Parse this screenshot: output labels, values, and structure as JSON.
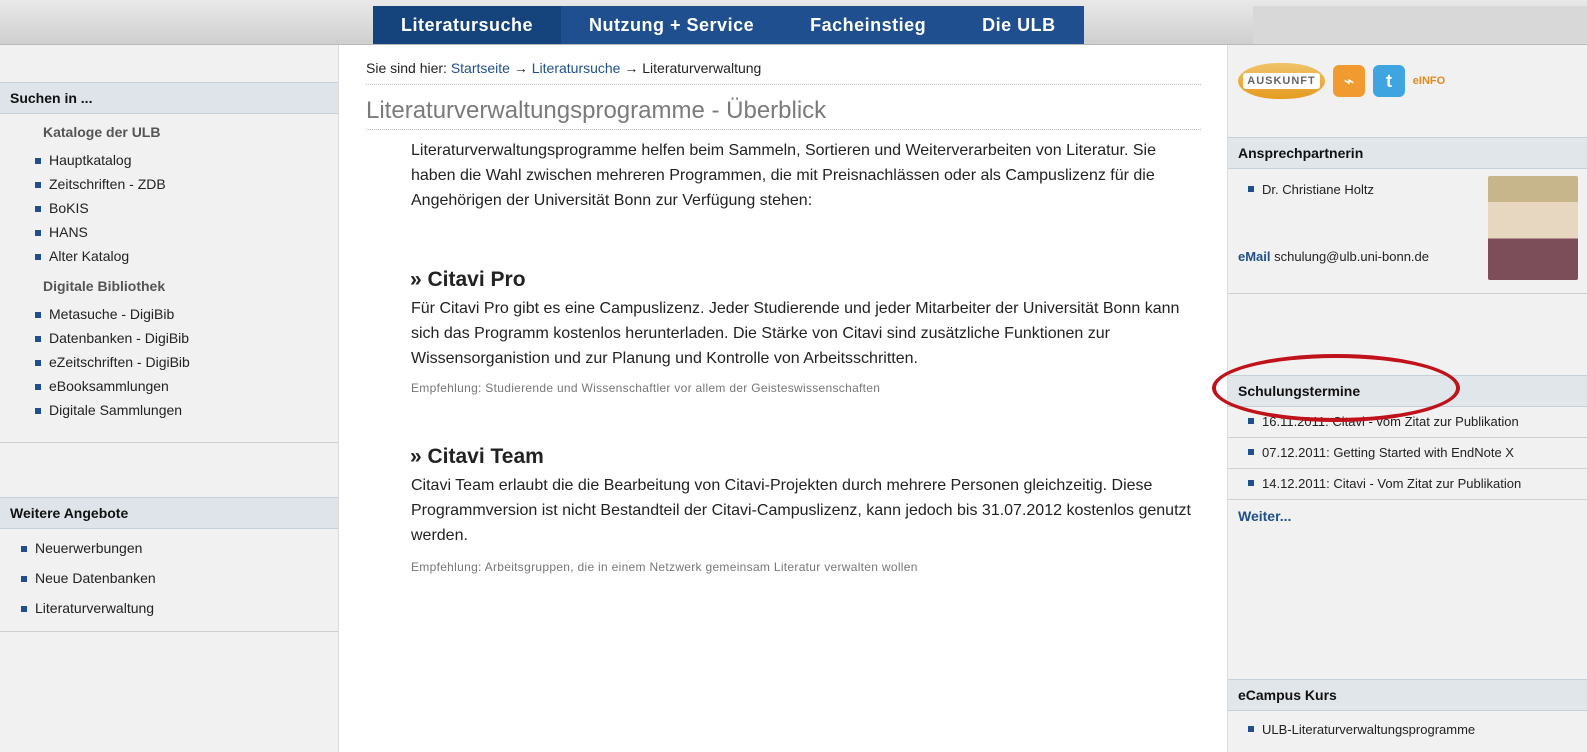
{
  "top_nav": {
    "items": [
      "Literatursuche",
      "Nutzung + Service",
      "Facheinstieg",
      "Die ULB"
    ]
  },
  "left_sidebar": {
    "section1_title": "Suchen in ...",
    "kataloge_title": "Kataloge der ULB",
    "kataloge_items": [
      "Hauptkatalog",
      "Zeitschriften - ZDB",
      "BoKIS",
      "HANS",
      "Alter Katalog"
    ],
    "digitale_title": "Digitale Bibliothek",
    "digitale_items": [
      "Metasuche - DigiBib",
      "Datenbanken - DigiBib",
      "eZeitschriften - DigiBib",
      "eBooksammlungen",
      "Digitale Sammlungen"
    ],
    "section2_title": "Weitere Angebote",
    "weitere_items": [
      "Neuerwerbungen",
      "Neue Datenbanken",
      "Literaturverwaltung"
    ]
  },
  "main": {
    "breadcrumb": {
      "prefix": "Sie sind hier: ",
      "link1": "Startseite",
      "arrow": " → ",
      "link2": "Literatursuche",
      "current": "Literaturverwaltung"
    },
    "title": "Literaturverwaltungsprogramme - Überblick",
    "intro": "Literaturverwaltungsprogramme helfen beim Sammeln, Sortieren und Weiterverarbeiten von Literatur.  Sie haben die Wahl zwischen mehreren Programmen, die mit Preisnachlässen oder als Campuslizenz für die Angehörigen der Universität Bonn zur Verfügung stehen:",
    "sections": [
      {
        "heading": "» Citavi Pro",
        "text": "Für Citavi Pro gibt es eine Campuslizenz. Jeder Studierende und jeder Mitarbeiter der Universität Bonn kann sich das Programm kostenlos herunterladen. Die Stärke von Citavi sind zusätzliche Funktionen zur Wissensorganistion und zur Planung und Kontrolle von Arbeitsschritten.",
        "recommendation": "Empfehlung: Studierende und Wissenschaftler vor allem der Geisteswissenschaften"
      },
      {
        "heading": "» Citavi Team",
        "text": "Citavi Team erlaubt die die Bearbeitung von Citavi-Projekten durch mehrere Personen gleichzeitig. Diese Programmversion ist nicht Bestandteil der Citavi-Campuslizenz, kann jedoch bis 31.07.2012 kostenlos genutzt werden.",
        "recommendation": "Empfehlung: Arbeitsgruppen, die in einem Netzwerk gemeinsam Literatur verwalten wollen"
      }
    ]
  },
  "right_sidebar": {
    "auskunft_label": "AUSKUNFT",
    "einfo_label": "eINFO",
    "contact_title": "Ansprechpartnerin",
    "contact_name": "Dr. Christiane Holtz",
    "email_label": "eMail",
    "email_value": "schulung@ulb.uni-bonn.de",
    "schulung_title": "Schulungstermine",
    "schulung_items": [
      "16.11.2011: Citavi - vom Zitat zur Publikation",
      "07.12.2011: Getting Started with EndNote X",
      "14.12.2011: Citavi - Vom Zitat zur Publikation"
    ],
    "weiter": "Weiter...",
    "ecampus_title": "eCampus Kurs",
    "ecampus_items": [
      "ULB-Literaturverwaltungsprogramme"
    ]
  },
  "colors": {
    "nav_blue": "#1f4f8e",
    "highlight_ellipse": "#c0121a"
  }
}
